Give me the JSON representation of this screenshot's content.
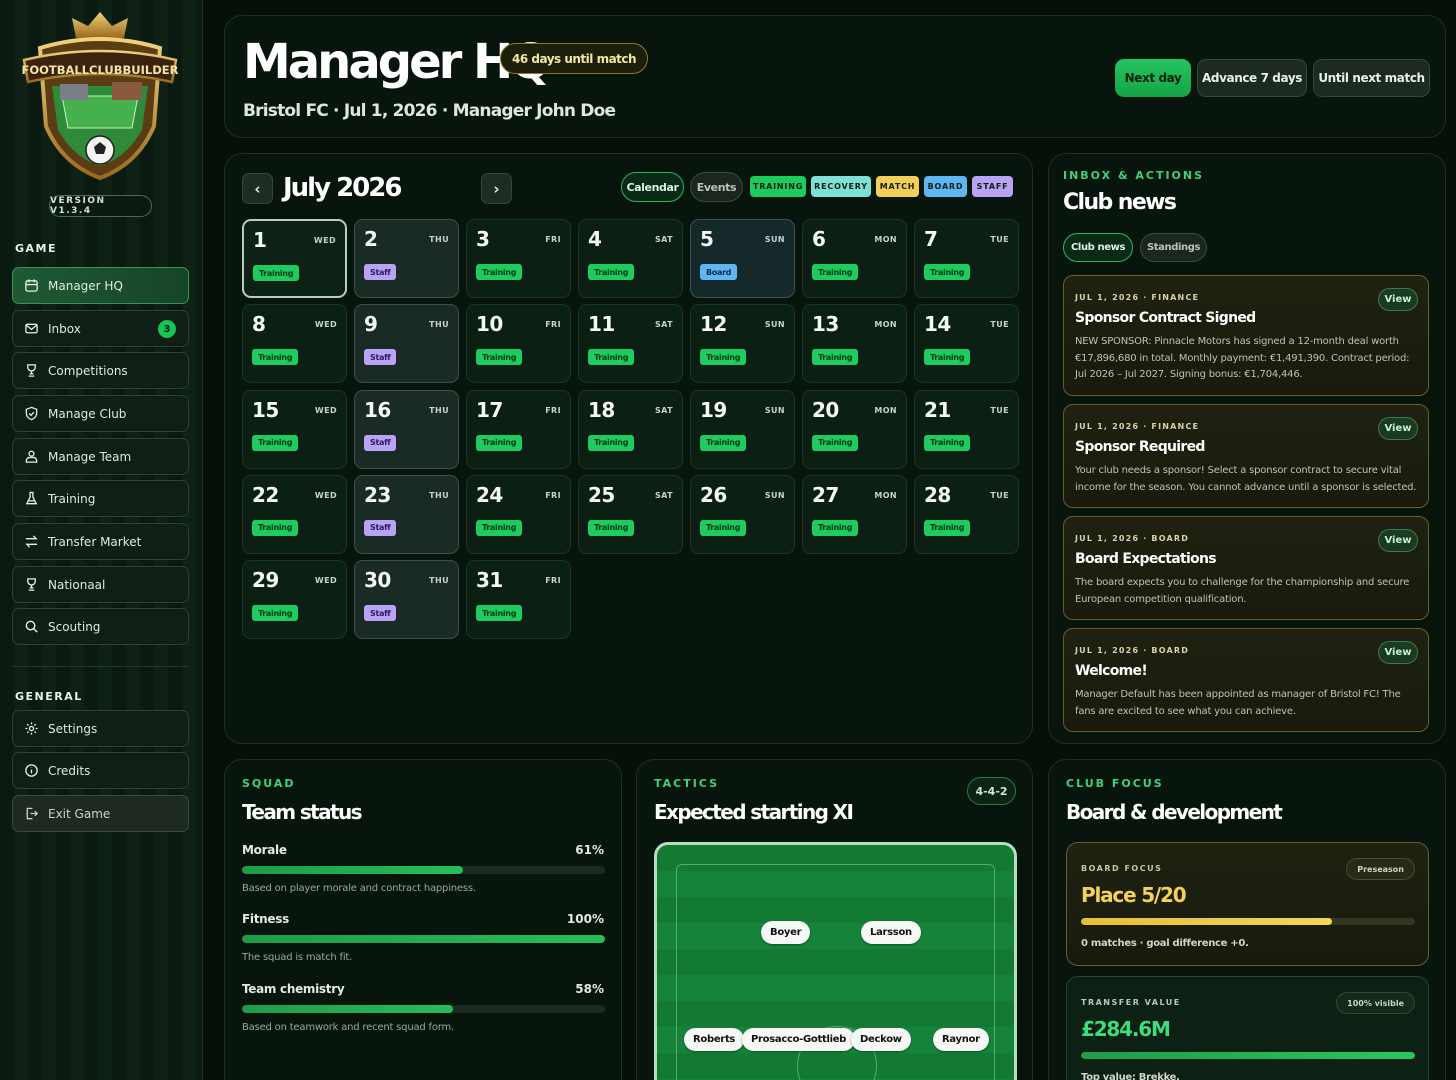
{
  "sidebar": {
    "logo_text": "FOOTBALLCLUBBUILDER",
    "version": "VERSION V1.3.4",
    "game_section": "GAME",
    "general_section": "GENERAL",
    "game_items": [
      {
        "label": "Manager HQ",
        "icon": "calendar-icon",
        "active": true
      },
      {
        "label": "Inbox",
        "icon": "mail-icon",
        "count": "3"
      },
      {
        "label": "Competitions",
        "icon": "trophy-icon"
      },
      {
        "label": "Manage Club",
        "icon": "shield-icon"
      },
      {
        "label": "Manage Team",
        "icon": "team-icon"
      },
      {
        "label": "Training",
        "icon": "flask-icon"
      },
      {
        "label": "Transfer Market",
        "icon": "transfer-icon"
      },
      {
        "label": "Nationaal",
        "icon": "trophy-icon"
      },
      {
        "label": "Scouting",
        "icon": "search-icon"
      }
    ],
    "general_items": [
      {
        "label": "Settings",
        "icon": "gear-icon"
      },
      {
        "label": "Credits",
        "icon": "info-icon"
      },
      {
        "label": "Exit Game",
        "icon": "exit-icon"
      }
    ]
  },
  "header": {
    "title": "Manager HQ",
    "days_until_match": "46 days until match",
    "subtitle": "Bristol FC · Jul 1, 2026 · Manager John Doe",
    "buttons": {
      "next_day": "Next day",
      "advance_7": "Advance 7 days",
      "until_match": "Until next match"
    }
  },
  "calendar": {
    "month": "July 2026",
    "prev_symbol": "‹",
    "next_symbol": "›",
    "tabs": {
      "calendar": "Calendar",
      "events": "Events"
    },
    "legend": [
      {
        "label": "TRAINING",
        "color": "#1dcb5e"
      },
      {
        "label": "RECOVERY",
        "color": "#7ee0d6"
      },
      {
        "label": "MATCH",
        "color": "#f3cf5a"
      },
      {
        "label": "BOARD",
        "color": "#5fb6f2"
      },
      {
        "label": "STAFF",
        "color": "#b9a3f5"
      }
    ],
    "days": [
      {
        "num": "1",
        "dow": "WED",
        "tag": "Training",
        "kind": "training"
      },
      {
        "num": "2",
        "dow": "THU",
        "tag": "Staff",
        "kind": "staff"
      },
      {
        "num": "3",
        "dow": "FRI",
        "tag": "Training",
        "kind": "training"
      },
      {
        "num": "4",
        "dow": "SAT",
        "tag": "Training",
        "kind": "training"
      },
      {
        "num": "5",
        "dow": "SUN",
        "tag": "Board",
        "kind": "board"
      },
      {
        "num": "6",
        "dow": "MON",
        "tag": "Training",
        "kind": "training"
      },
      {
        "num": "7",
        "dow": "TUE",
        "tag": "Training",
        "kind": "training"
      },
      {
        "num": "8",
        "dow": "WED",
        "tag": "Training",
        "kind": "training"
      },
      {
        "num": "9",
        "dow": "THU",
        "tag": "Staff",
        "kind": "staff"
      },
      {
        "num": "10",
        "dow": "FRI",
        "tag": "Training",
        "kind": "training"
      },
      {
        "num": "11",
        "dow": "SAT",
        "tag": "Training",
        "kind": "training"
      },
      {
        "num": "12",
        "dow": "SUN",
        "tag": "Training",
        "kind": "training"
      },
      {
        "num": "13",
        "dow": "MON",
        "tag": "Training",
        "kind": "training"
      },
      {
        "num": "14",
        "dow": "TUE",
        "tag": "Training",
        "kind": "training"
      },
      {
        "num": "15",
        "dow": "WED",
        "tag": "Training",
        "kind": "training"
      },
      {
        "num": "16",
        "dow": "THU",
        "tag": "Staff",
        "kind": "staff"
      },
      {
        "num": "17",
        "dow": "FRI",
        "tag": "Training",
        "kind": "training"
      },
      {
        "num": "18",
        "dow": "SAT",
        "tag": "Training",
        "kind": "training"
      },
      {
        "num": "19",
        "dow": "SUN",
        "tag": "Training",
        "kind": "training"
      },
      {
        "num": "20",
        "dow": "MON",
        "tag": "Training",
        "kind": "training"
      },
      {
        "num": "21",
        "dow": "TUE",
        "tag": "Training",
        "kind": "training"
      },
      {
        "num": "22",
        "dow": "WED",
        "tag": "Training",
        "kind": "training"
      },
      {
        "num": "23",
        "dow": "THU",
        "tag": "Staff",
        "kind": "staff"
      },
      {
        "num": "24",
        "dow": "FRI",
        "tag": "Training",
        "kind": "training"
      },
      {
        "num": "25",
        "dow": "SAT",
        "tag": "Training",
        "kind": "training"
      },
      {
        "num": "26",
        "dow": "SUN",
        "tag": "Training",
        "kind": "training"
      },
      {
        "num": "27",
        "dow": "MON",
        "tag": "Training",
        "kind": "training"
      },
      {
        "num": "28",
        "dow": "TUE",
        "tag": "Training",
        "kind": "training"
      },
      {
        "num": "29",
        "dow": "WED",
        "tag": "Training",
        "kind": "training"
      },
      {
        "num": "30",
        "dow": "THU",
        "tag": "Staff",
        "kind": "staff"
      },
      {
        "num": "31",
        "dow": "FRI",
        "tag": "Training",
        "kind": "training"
      }
    ]
  },
  "news": {
    "kicker": "INBOX & ACTIONS",
    "title": "Club news",
    "tabs": {
      "club_news": "Club news",
      "standings": "Standings"
    },
    "view_label": "View",
    "items": [
      {
        "meta": "JUL 1, 2026 · FINANCE",
        "title": "Sponsor Contract Signed",
        "body": "NEW SPONSOR: Pinnacle Motors has signed a 12-month deal worth €17,896,680 in total. Monthly payment: €1,491,390. Contract period: Jul 2026 – Jul 2027. Signing bonus: €1,704,446."
      },
      {
        "meta": "JUL 1, 2026 · FINANCE",
        "title": "Sponsor Required",
        "body": "Your club needs a sponsor! Select a sponsor contract to secure vital income for the season. You cannot advance until a sponsor is selected."
      },
      {
        "meta": "JUL 1, 2026 · BOARD",
        "title": "Board Expectations",
        "body": "The board expects you to challenge for the championship and secure European competition qualification."
      },
      {
        "meta": "JUL 1, 2026 · BOARD",
        "title": "Welcome!",
        "body": "Manager Default has been appointed as manager of Bristol FC! The fans are excited to see what you can achieve."
      }
    ]
  },
  "squad": {
    "kicker": "SQUAD",
    "title": "Team status",
    "stats": [
      {
        "label": "Morale",
        "value": "61%",
        "fraction": 0.61,
        "note": "Based on player morale and contract happiness."
      },
      {
        "label": "Fitness",
        "value": "100%",
        "fraction": 1.0,
        "note": "The squad is match fit."
      },
      {
        "label": "Team chemistry",
        "value": "58%",
        "fraction": 0.58,
        "note": "Based on teamwork and recent squad form."
      }
    ]
  },
  "tactics": {
    "kicker": "TACTICS",
    "title": "Expected starting XI",
    "formation": "4-4-2",
    "players": {
      "forwards": [
        "Boyer",
        "Larsson"
      ],
      "midfield": [
        "Roberts",
        "Prosacco-Gottlieb",
        "Deckow",
        "Raynor"
      ]
    }
  },
  "focus": {
    "kicker": "CLUB FOCUS",
    "title": "Board & development",
    "board": {
      "kicker": "BOARD FOCUS",
      "pill": "Preseason",
      "value": "Place 5/20",
      "fraction": 0.75,
      "note": "0 matches · goal difference +0."
    },
    "transfer": {
      "kicker": "TRANSFER VALUE",
      "pill": "100% visible",
      "value": "£284.6M",
      "fraction": 1.0,
      "note": "Top value: Brekke."
    }
  }
}
